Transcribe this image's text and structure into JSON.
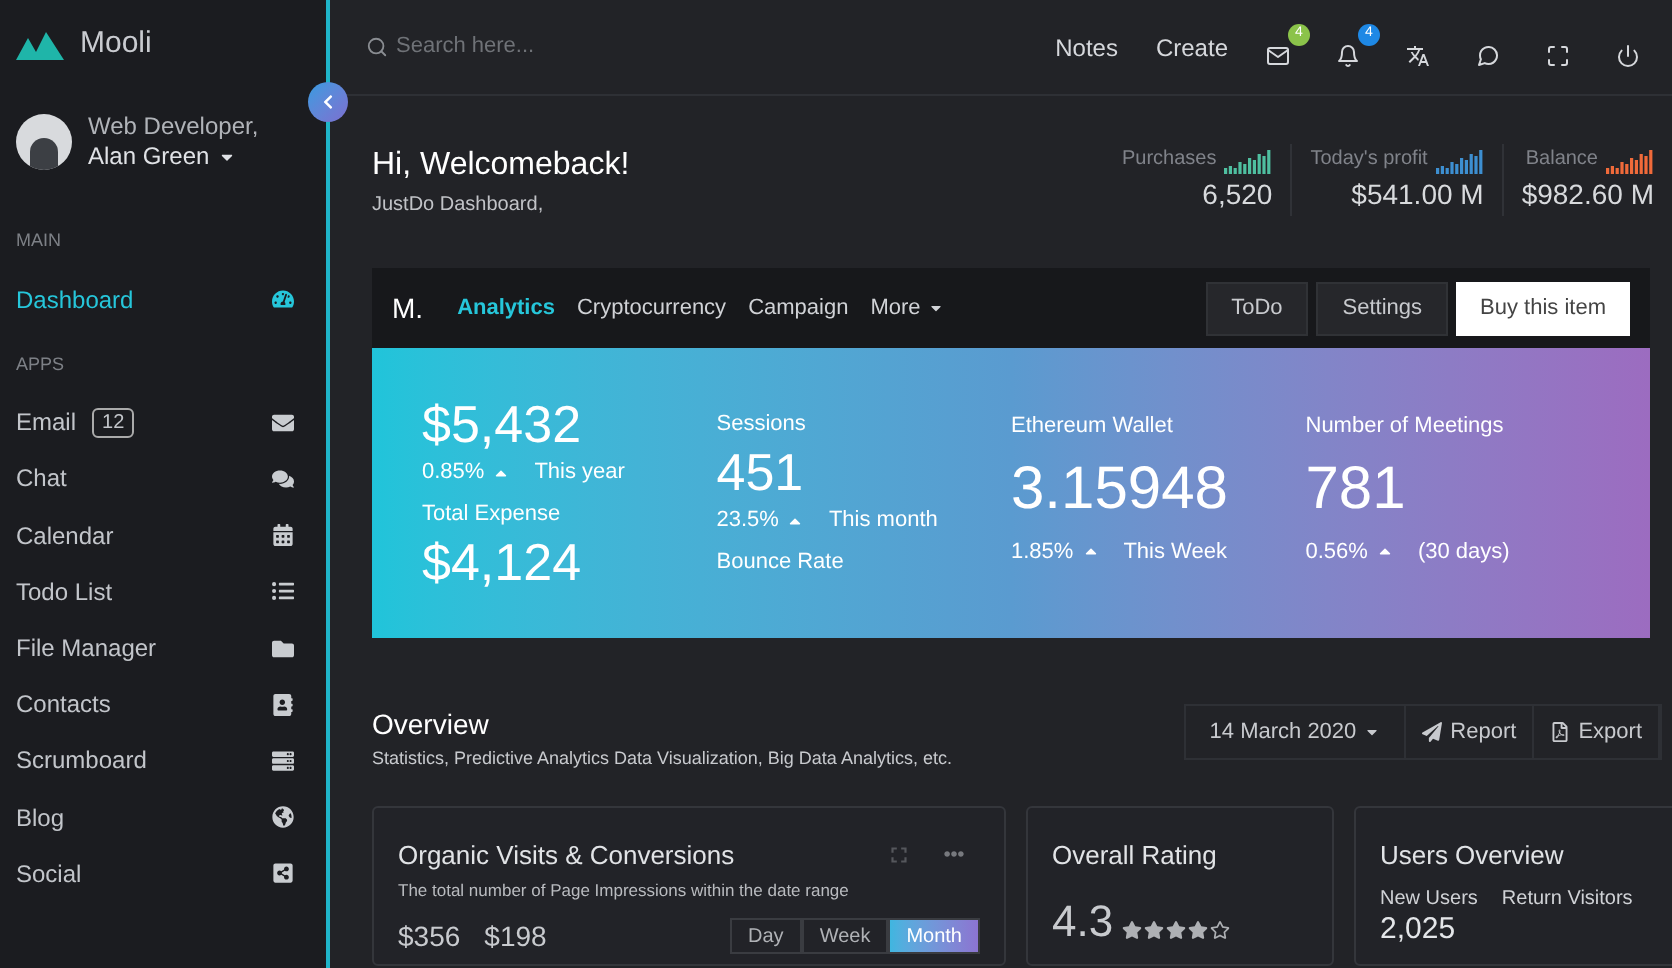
{
  "brand": {
    "name": "Mooli"
  },
  "user": {
    "role": "Web Developer,",
    "name": "Alan Green"
  },
  "sidebar": {
    "sections": [
      {
        "title": "MAIN",
        "items": [
          {
            "label": "Dashboard",
            "selected": true
          }
        ]
      },
      {
        "title": "APPS",
        "items": [
          {
            "label": "Email",
            "badge": "12",
            "selected": false
          },
          {
            "label": "Chat",
            "selected": false
          },
          {
            "label": "Calendar",
            "selected": false
          },
          {
            "label": "Todo List",
            "selected": false
          },
          {
            "label": "File Manager",
            "selected": false
          },
          {
            "label": "Contacts",
            "selected": false
          },
          {
            "label": "Scrumboard",
            "selected": false
          },
          {
            "label": "Blog",
            "selected": false
          },
          {
            "label": "Social",
            "selected": false
          }
        ]
      }
    ]
  },
  "search": {
    "placeholder": "Search here..."
  },
  "top_links": [
    "Notes",
    "Create"
  ],
  "top_badges": [
    {
      "badge": "4",
      "color": "#8bc34a"
    },
    {
      "badge": "4",
      "color": "#1e88e5"
    }
  ],
  "welcome": {
    "title": "Hi, Welcomeback!",
    "subtitle": "JustDo Dashboard,"
  },
  "stats": [
    {
      "label": "Purchases",
      "value": "6,520",
      "color": "#4fbfa0"
    },
    {
      "label": "Today's profit",
      "value": "$541.00 M",
      "color": "#3d8fd1"
    },
    {
      "label": "Balance",
      "value": "$982.60 M",
      "color": "#f06a3a"
    }
  ],
  "navbar": {
    "brand": "M.",
    "tabs": [
      {
        "label": "Analytics",
        "selected": true
      },
      {
        "label": "Cryptocurrency",
        "selected": false
      },
      {
        "label": "Campaign",
        "selected": false
      },
      {
        "label": "More",
        "selected": false,
        "kind": "dropdown"
      }
    ],
    "buttons": [
      {
        "label": "ToDo",
        "kind": "dark"
      },
      {
        "label": "Settings",
        "kind": "dark"
      },
      {
        "label": "Buy this item",
        "kind": "light"
      }
    ]
  },
  "hero": [
    {
      "items": [
        {
          "value": "$5,432",
          "change": "0.85%",
          "period": "This year"
        },
        {
          "label": "Total Expense",
          "value": "$4,124"
        }
      ]
    },
    {
      "items": [
        {
          "label": "Sessions",
          "value": "451",
          "change": "23.5%",
          "period": "This month"
        },
        {
          "label": "Bounce Rate"
        }
      ]
    },
    {
      "items": [
        {
          "label": "Ethereum Wallet",
          "value": "3.15948",
          "change": "1.85%",
          "period": "This Week"
        }
      ]
    },
    {
      "items": [
        {
          "label": "Number of Meetings",
          "value": "781",
          "change": "0.56%",
          "period": "(30 days)"
        }
      ]
    }
  ],
  "overview": {
    "title": "Overview",
    "subtitle": "Statistics, Predictive Analytics Data Visualization, Big Data Analytics, etc.",
    "date": "14 March 2020",
    "actions": [
      {
        "label": "Report"
      },
      {
        "label": "Export"
      }
    ]
  },
  "cards": [
    {
      "kind": "visits",
      "title": "Organic Visits & Conversions",
      "subtitle": "The total number of Page Impressions within the date range",
      "values": [
        "$356",
        "$198"
      ],
      "ranges": [
        {
          "label": "Day",
          "selected": false
        },
        {
          "label": "Week",
          "selected": false
        },
        {
          "label": "Month",
          "selected": true
        }
      ]
    },
    {
      "kind": "rating",
      "title": "Overall Rating",
      "value": "4.3",
      "stars": 4
    },
    {
      "kind": "users",
      "title": "Users Overview",
      "items": [
        {
          "label": "New Users",
          "value": "2,025"
        },
        {
          "label": "Return Visitors"
        }
      ]
    }
  ]
}
